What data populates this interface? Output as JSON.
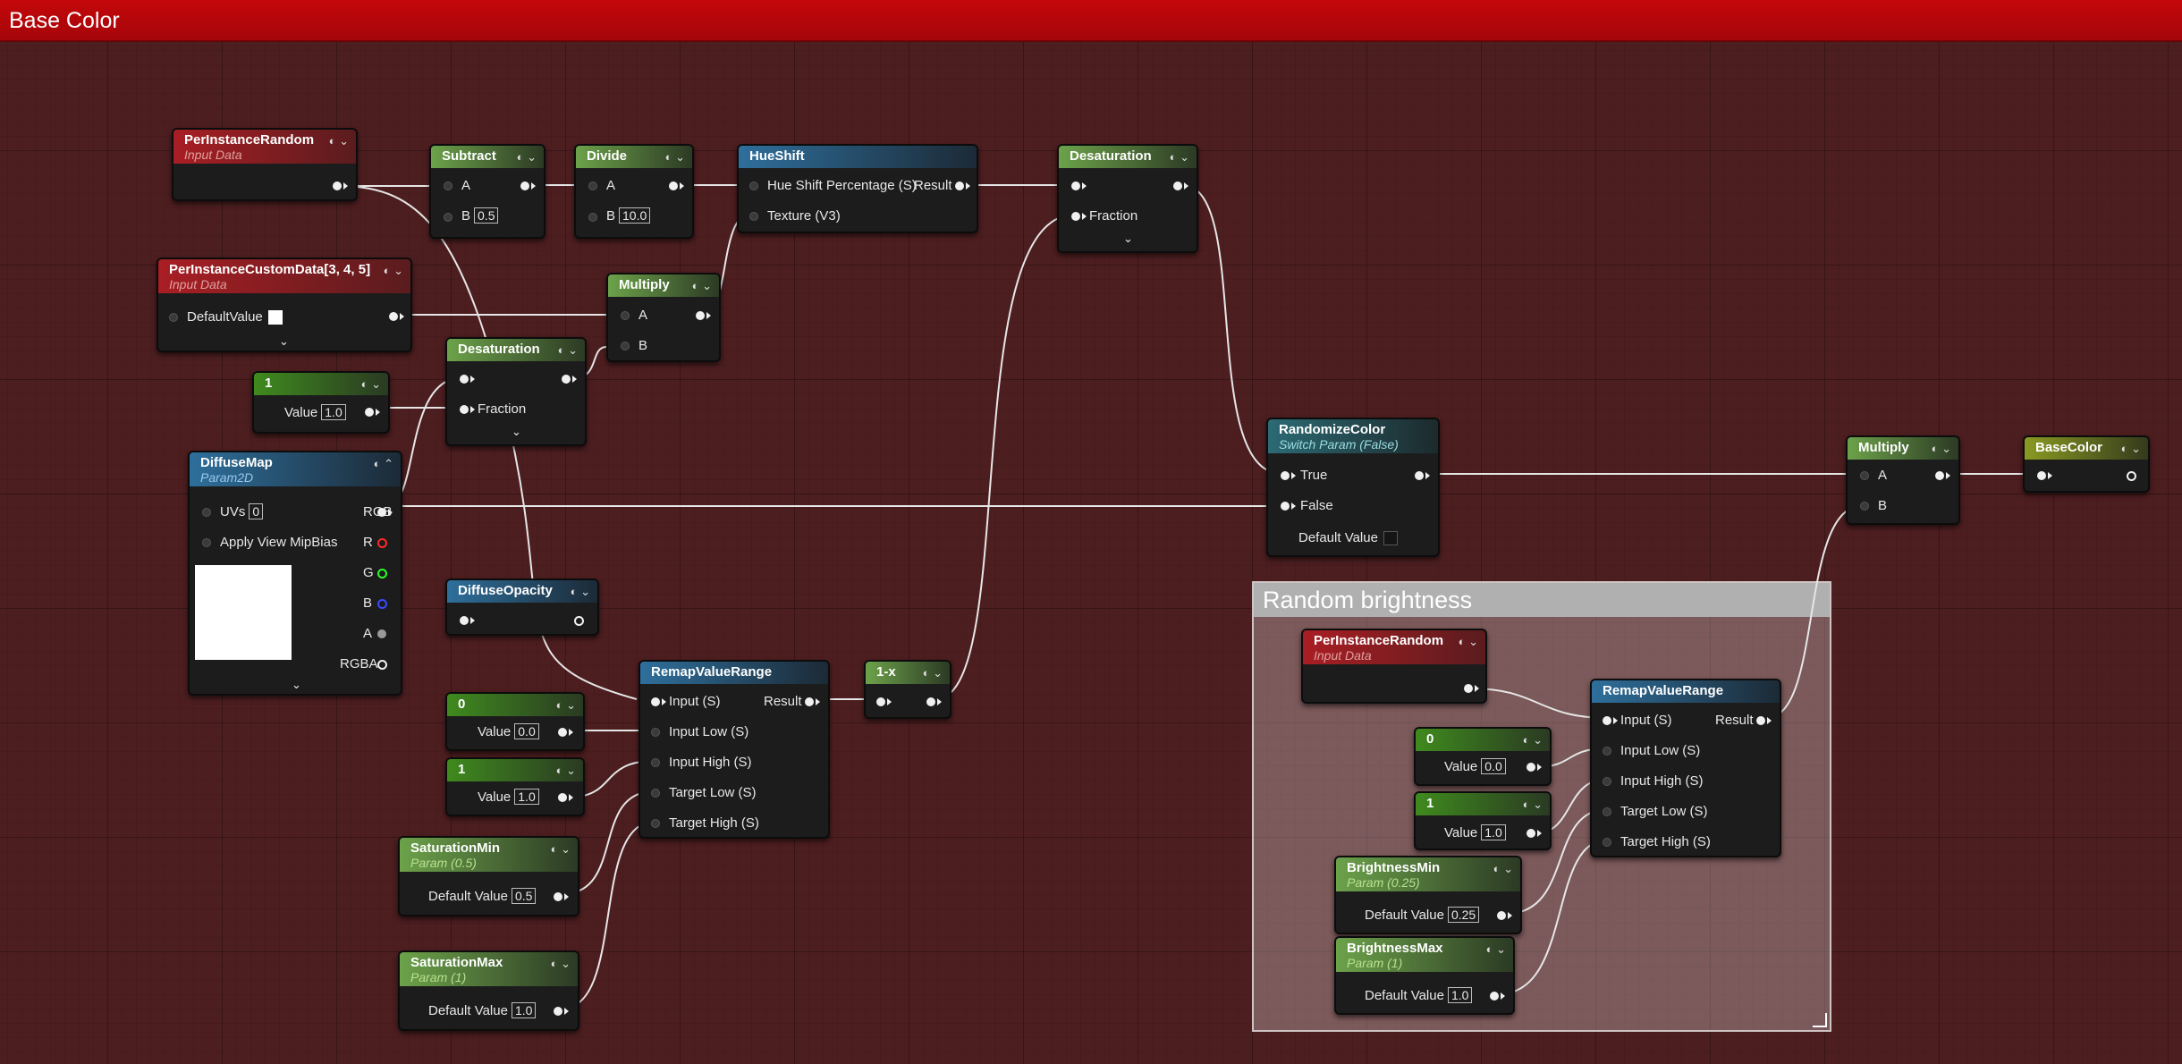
{
  "window": {
    "title": "Base Color"
  },
  "comment": {
    "title": "Random brightness"
  },
  "nodes": {
    "pir1": {
      "title": "PerInstanceRandom",
      "subtitle": "Input Data"
    },
    "pcd": {
      "title": "PerInstanceCustomData[3, 4, 5]",
      "subtitle": "Input Data",
      "default_label": "DefaultValue"
    },
    "const1a": {
      "title": "1",
      "value_label": "Value",
      "value": "1.0"
    },
    "diffuse": {
      "title": "DiffuseMap",
      "subtitle": "Param2D",
      "uvs_label": "UVs",
      "uvs_value": "0",
      "mip_label": "Apply View MipBias",
      "rgb": "RGB",
      "r": "R",
      "g": "G",
      "b": "B",
      "a": "A",
      "rgba": "RGBA"
    },
    "subtract": {
      "title": "Subtract",
      "a": "A",
      "b": "B",
      "b_value": "0.5"
    },
    "divide": {
      "title": "Divide",
      "a": "A",
      "b": "B",
      "b_value": "10.0"
    },
    "hueshift": {
      "title": "HueShift",
      "in1": "Hue Shift Percentage (S)",
      "in2": "Texture (V3)",
      "out": "Result"
    },
    "multiply1": {
      "title": "Multiply",
      "a": "A",
      "b": "B"
    },
    "desat1": {
      "title": "Desaturation",
      "fraction": "Fraction"
    },
    "desat2": {
      "title": "Desaturation",
      "fraction": "Fraction"
    },
    "diffop": {
      "title": "DiffuseOpacity"
    },
    "remap1": {
      "title": "RemapValueRange",
      "in": "Input (S)",
      "lo": "Input Low (S)",
      "hi": "Input High (S)",
      "tlo": "Target Low (S)",
      "thi": "Target High (S)",
      "out": "Result"
    },
    "oneminus": {
      "title": "1-x"
    },
    "c0a": {
      "title": "0",
      "value_label": "Value",
      "value": "0.0"
    },
    "c1b": {
      "title": "1",
      "value_label": "Value",
      "value": "1.0"
    },
    "satmin": {
      "title": "SaturationMin",
      "subtitle": "Param (0.5)",
      "label": "Default Value",
      "value": "0.5"
    },
    "satmax": {
      "title": "SaturationMax",
      "subtitle": "Param (1)",
      "label": "Default Value",
      "value": "1.0"
    },
    "randcolor": {
      "title": "RandomizeColor",
      "subtitle": "Switch Param (False)",
      "true": "True",
      "false": "False",
      "default": "Default Value"
    },
    "multiply2": {
      "title": "Multiply",
      "a": "A",
      "b": "B"
    },
    "basecolor": {
      "title": "BaseColor"
    },
    "pir2": {
      "title": "PerInstanceRandom",
      "subtitle": "Input Data"
    },
    "remap2": {
      "title": "RemapValueRange",
      "in": "Input (S)",
      "lo": "Input Low (S)",
      "hi": "Input High (S)",
      "tlo": "Target Low (S)",
      "thi": "Target High (S)",
      "out": "Result"
    },
    "c0b": {
      "title": "0",
      "value_label": "Value",
      "value": "0.0"
    },
    "c1c": {
      "title": "1",
      "value_label": "Value",
      "value": "1.0"
    },
    "brmin": {
      "title": "BrightnessMin",
      "subtitle": "Param (0.25)",
      "label": "Default Value",
      "value": "0.25"
    },
    "brmax": {
      "title": "BrightnessMax",
      "subtitle": "Param (1)",
      "label": "Default Value",
      "value": "1.0"
    }
  }
}
